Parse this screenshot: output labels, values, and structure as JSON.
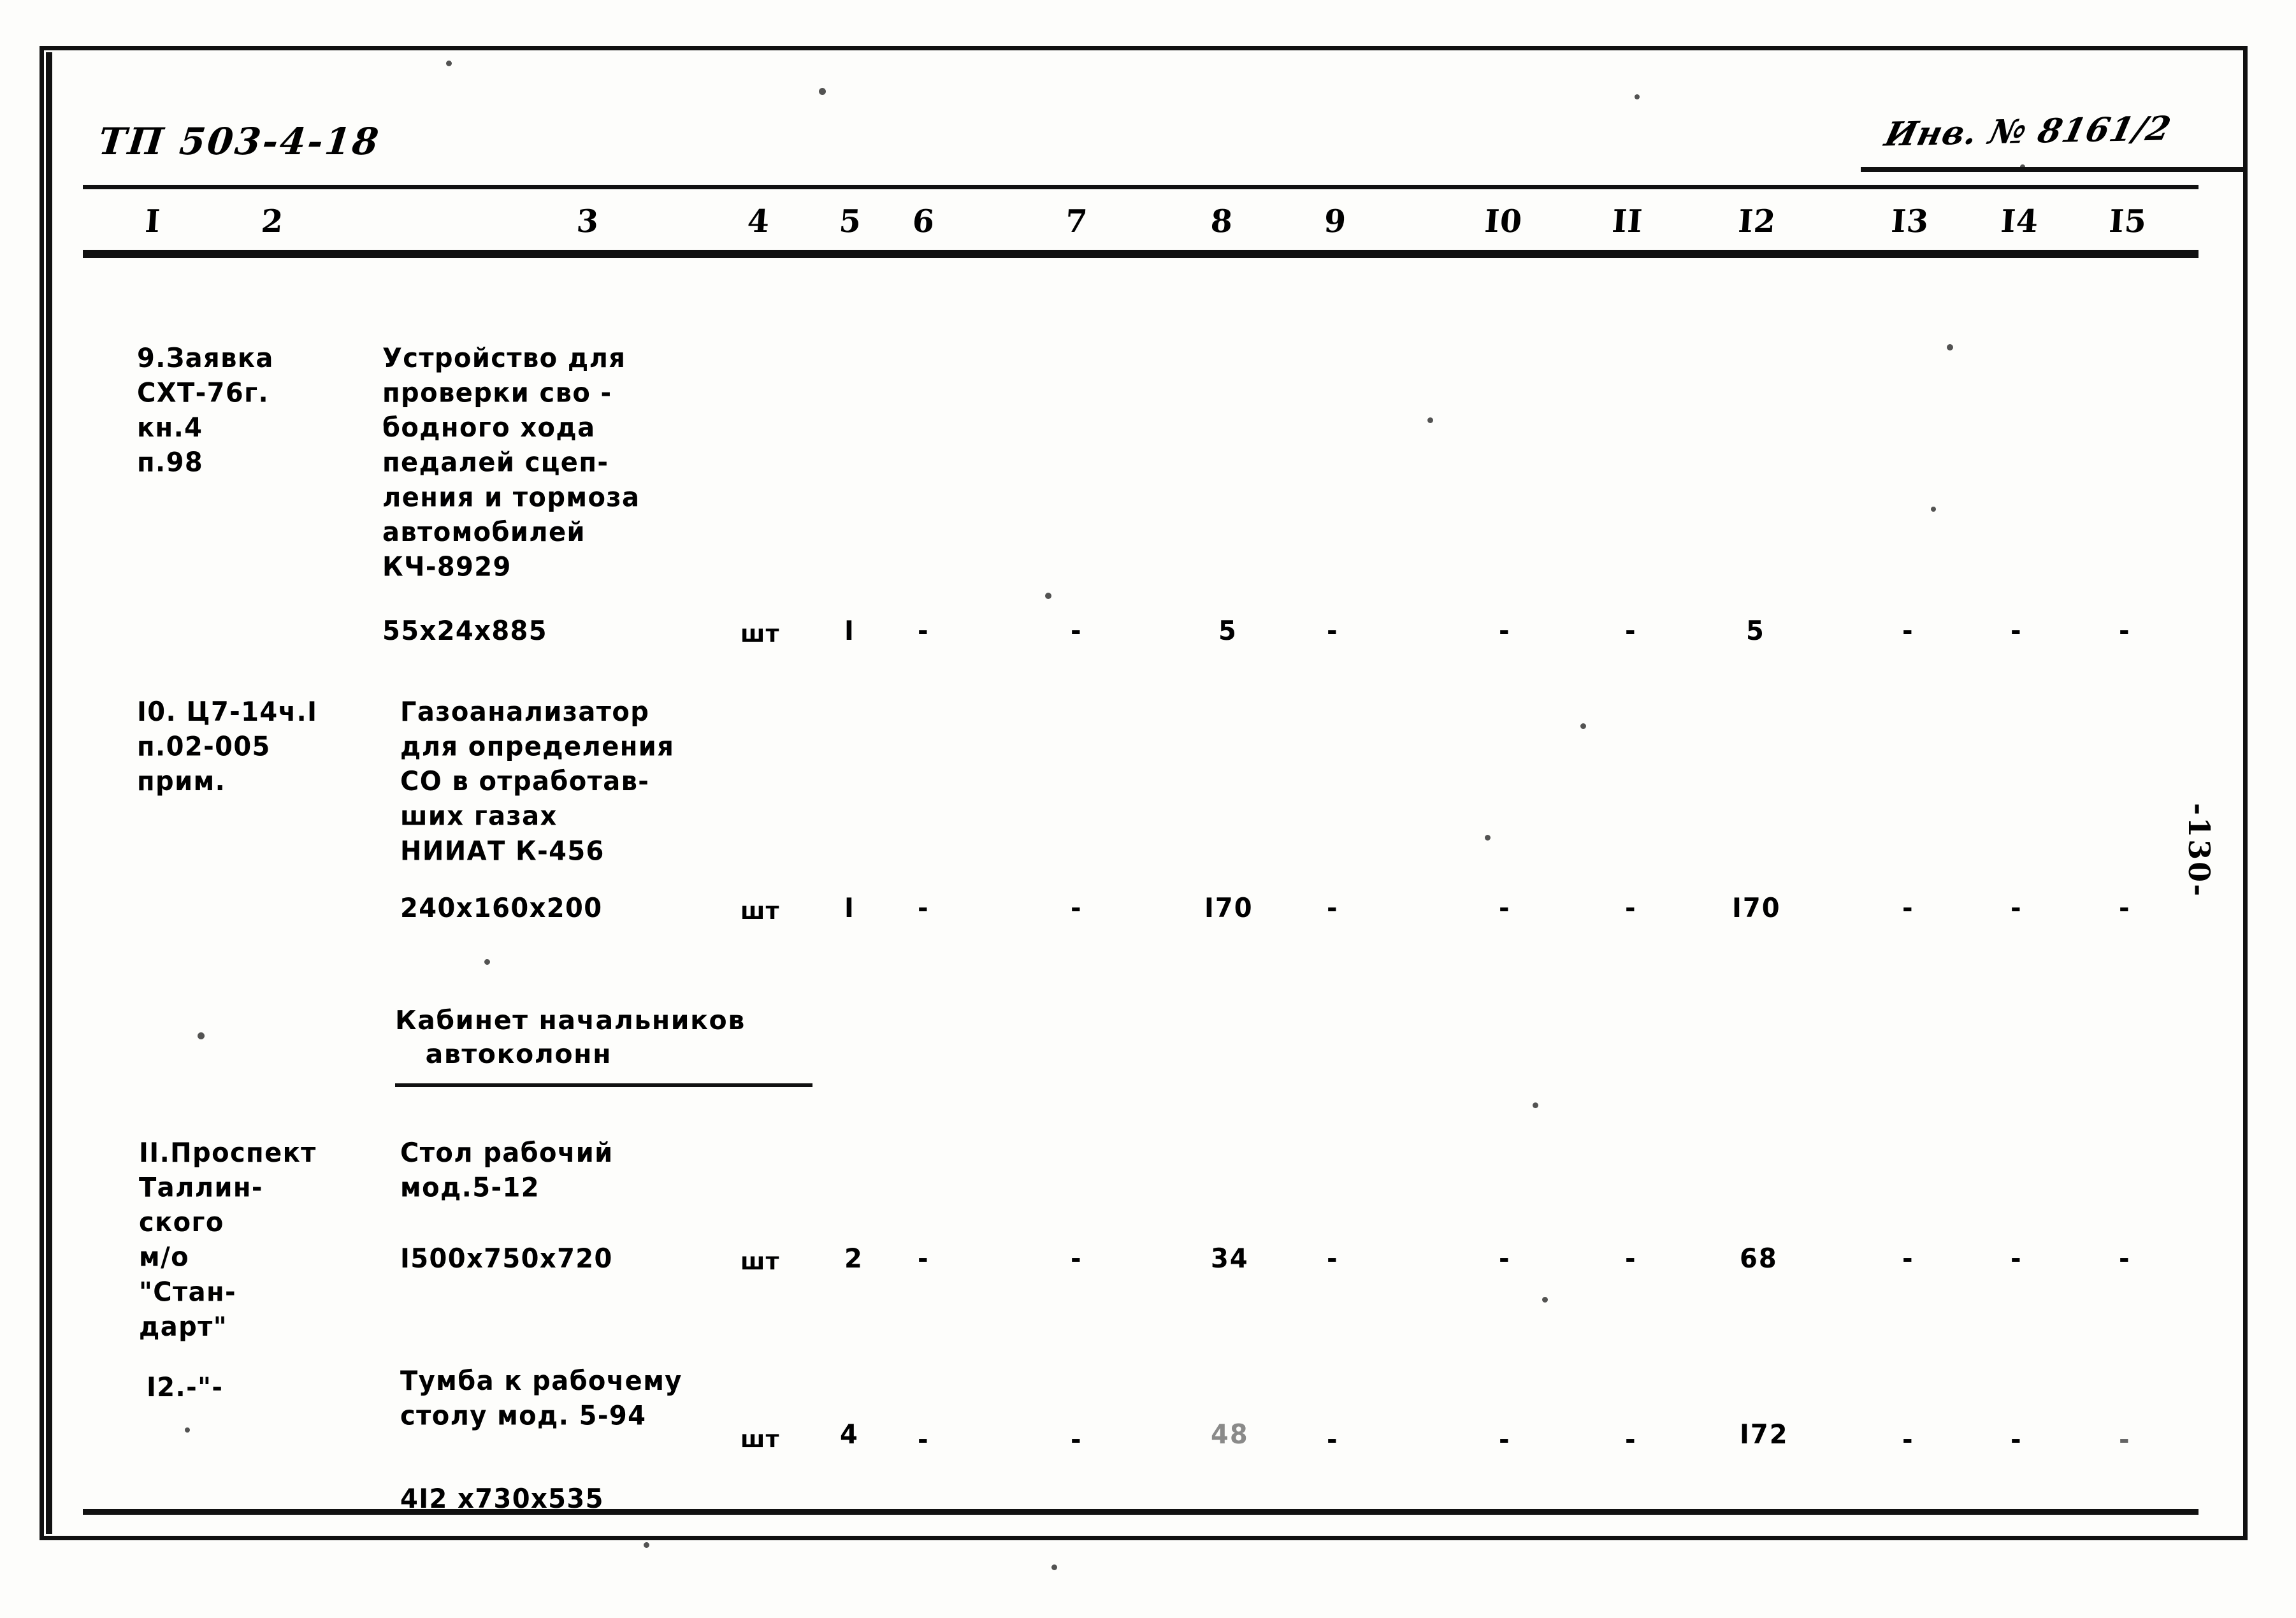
{
  "document": {
    "code": "ТП 503-4-18",
    "inventory_number": "Инв. № 8161/2",
    "page_number": "-130-"
  },
  "table": {
    "column_numbers": [
      "I",
      "2",
      "3",
      "4",
      "5",
      "6",
      "7",
      "8",
      "9",
      "I0",
      "II",
      "I2",
      "I3",
      "I4",
      "I5"
    ],
    "rows": [
      {
        "no": "9.",
        "source": "9.Заявка\nСХТ-76г.\nкн.4\nп.98",
        "description": "Устройство для\nпроверки сво -\nбодного хода\nпедалей сцеп-\nления и тормоза\nавтомобилей\nКЧ-8929",
        "dimensions": "55х24х885",
        "unit": "шт",
        "col5": "I",
        "col6": "-",
        "col7": "-",
        "col8": "5",
        "col9": "-",
        "col10": "-",
        "col11": "-",
        "col12": "5",
        "col13": "-",
        "col14": "-",
        "col15": "-"
      },
      {
        "no": "I0.",
        "source": "I0. Ц7-14ч.I\nп.02-005\nприм.",
        "description": "Газоанализатор\nдля определения\nСО в отработав-\nших газах\nНИИАТ К-456",
        "dimensions": "240х160х200",
        "unit": "шт",
        "col5": "I",
        "col6": "-",
        "col7": "-",
        "col8": "I70",
        "col9": "-",
        "col10": "-",
        "col11": "-",
        "col12": "I70",
        "col13": "-",
        "col14": "-",
        "col15": "-"
      },
      {
        "no": "II.",
        "source": "II.Проспект\nТаллин-\nского\nм/о\n\"Стан-\nдарт\"",
        "description": "Стол рабочий\nмод.5-12",
        "dimensions": "I500х750х720",
        "unit": "шт",
        "col5": "2",
        "col6": "-",
        "col7": "-",
        "col8": "34",
        "col9": "-",
        "col10": "-",
        "col11": "-",
        "col12": "68",
        "col13": "-",
        "col14": "-",
        "col15": "-"
      },
      {
        "no": "I2.",
        "source": "I2.-\"-",
        "description": "Тумба к рабочему\nстолу мод. 5-94",
        "dimensions": "4I2 х730х535",
        "unit": "шт",
        "col5": "4",
        "col6": "-",
        "col7": "-",
        "col8": "48",
        "col9": "-",
        "col10": "-",
        "col11": "-",
        "col12": "I72",
        "col13": "-",
        "col14": "-",
        "col15": "-"
      }
    ],
    "section_heading": "Кабинет начальников\n   автоколонн"
  }
}
